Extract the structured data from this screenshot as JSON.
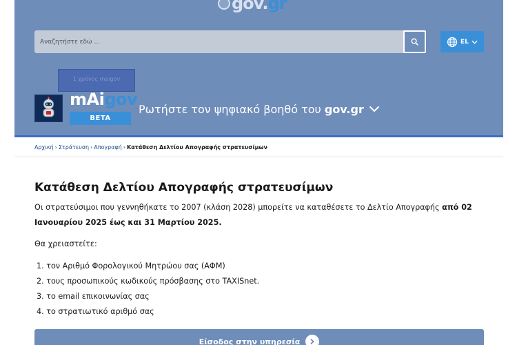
{
  "header": {
    "logo": {
      "text_main": "gov.",
      "text_accent": "gr"
    },
    "search": {
      "placeholder": "Αναζητήστε εδώ ..."
    },
    "language": {
      "label": "EL"
    }
  },
  "assistant": {
    "badge": "1 χρόνος maigov",
    "title_main": "mAi",
    "title_accent": "gov",
    "beta_label": "BETA",
    "prompt_text": "Ρωτήστε τον ψηφιακό βοηθό του ",
    "prompt_bold": "gov.gr"
  },
  "breadcrumb": {
    "items": [
      "Αρχική",
      "Στράτευση",
      "Απογραφή"
    ],
    "current": "Κατάθεση Δελτίου Απογραφής στρατευσίμων"
  },
  "content": {
    "title": "Κατάθεση Δελτίου Απογραφής στρατευσίμων",
    "intro_text": "Οι στρατεύσιμοι που γεννηθήκατε το 2007 (κλάση 2028) μπορείτε να καταθέσετε το Δελτίο Απογραφής ",
    "intro_bold": "από 02 Ιανουαρίου 2025 έως και 31 Μαρτίου 2025.",
    "need_label": "Θα χρειαστείτε:",
    "requirements": [
      "1. τον Αριθμό Φορολογικού Μητρώου σας (ΑΦΜ)",
      "2. τους προσωπικούς κωδικούς πρόσβασης στο TAXISnet.",
      "3. το email επικοινωνίας σας",
      "4. το στρατιωτικό αριθμό σας"
    ],
    "cta_label": "Είσοδος στην υπηρεσία"
  },
  "colors": {
    "header_bg": "#6f8db9",
    "accent": "#3a8fd9",
    "link": "#1f4e8c"
  }
}
